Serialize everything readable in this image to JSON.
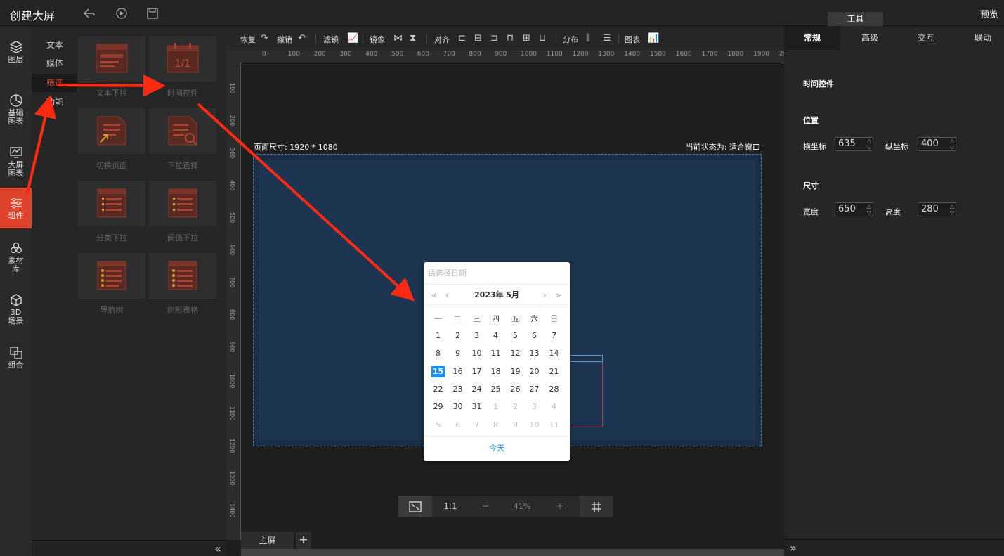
{
  "header": {
    "title": "创建大屏",
    "preview": "预览",
    "tool_tab": "工具"
  },
  "leftnav": [
    {
      "label": "图层",
      "icon": "layers-icon"
    },
    {
      "label": "基础\n图表",
      "icon": "pie-chart-icon"
    },
    {
      "label": "大屏\n图表",
      "icon": "monitor-chart-icon"
    },
    {
      "label": "组件",
      "icon": "sliders-icon",
      "active": true
    },
    {
      "label": "素材\n库",
      "icon": "materials-icon"
    },
    {
      "label": "3D\n场景",
      "icon": "cube-icon"
    },
    {
      "label": "组合",
      "icon": "group-icon"
    }
  ],
  "subnav": [
    "文本",
    "媒体",
    "筛选",
    "功能"
  ],
  "components": [
    "文本下拉",
    "时间控件",
    "切换页面",
    "下拉选择",
    "分类下拉",
    "阀值下拉",
    "导航树",
    "树形表格"
  ],
  "time_icon_text": "1/1",
  "toolbar": {
    "restore": "恢复",
    "undo": "撤销",
    "filter": "滤镜",
    "mirror": "镜像",
    "align": "对齐",
    "distribute": "分布",
    "chart": "图表"
  },
  "ruler_h": [
    "0",
    "100",
    "200",
    "300",
    "400",
    "500",
    "600",
    "700",
    "800",
    "900",
    "1000",
    "1100",
    "1200",
    "1300",
    "1400",
    "1500",
    "1600",
    "1700",
    "1800",
    "1900",
    "2000"
  ],
  "ruler_v": [
    "100",
    "200",
    "300",
    "400",
    "500",
    "600",
    "700",
    "800",
    "900",
    "1000",
    "1100",
    "1200",
    "1300",
    "1400"
  ],
  "canvas": {
    "page_size": "页面尺寸: 1920 * 1080",
    "state": "当前状态为: 适合窗口"
  },
  "datepicker": {
    "placeholder": "请选择日期",
    "header": "2023年 5月",
    "weekdays": [
      "一",
      "二",
      "三",
      "四",
      "五",
      "六",
      "日"
    ],
    "rows": [
      [
        "1",
        "2",
        "3",
        "4",
        "5",
        "6",
        "7"
      ],
      [
        "8",
        "9",
        "10",
        "11",
        "12",
        "13",
        "14"
      ],
      [
        "15",
        "16",
        "17",
        "18",
        "19",
        "20",
        "21"
      ],
      [
        "22",
        "23",
        "24",
        "25",
        "26",
        "27",
        "28"
      ],
      [
        "29",
        "30",
        "31",
        "1",
        "2",
        "3",
        "4"
      ],
      [
        "5",
        "6",
        "7",
        "8",
        "9",
        "10",
        "11"
      ]
    ],
    "today_label": "今天",
    "selected": "15"
  },
  "zoom": {
    "ratio": "1:1",
    "minus": "−",
    "value": "41%",
    "plus": "+"
  },
  "tabs": {
    "main": "主屏",
    "add": "+"
  },
  "rightpanel": {
    "tabs": [
      "常规",
      "高级",
      "交互",
      "联动"
    ],
    "component_name": "时间控件",
    "position_title": "位置",
    "x_label": "横坐标",
    "x_value": "635",
    "y_label": "纵坐标",
    "y_value": "400",
    "size_title": "尺寸",
    "w_label": "宽度",
    "w_value": "650",
    "h_label": "高度",
    "h_value": "280"
  },
  "colors": {
    "accent": "#e0432b",
    "link": "#1890ff",
    "screen_bg": "#1d3550"
  }
}
